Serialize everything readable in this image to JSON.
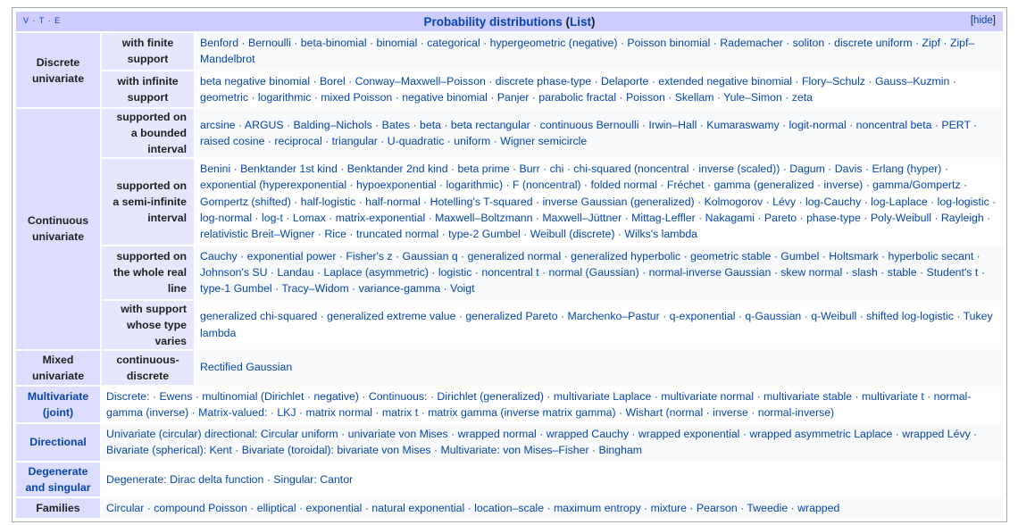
{
  "navbox": {
    "vte": "V · T · E",
    "title": "Probability distributions",
    "title_list": "List",
    "hide": "hide"
  },
  "groups": {
    "discrete": "Discrete univariate",
    "continuous": "Continuous univariate",
    "mixed": "Mixed univariate",
    "multivariate": "Multivariate (joint)",
    "directional": "Directional",
    "degenerate": "Degenerate and singular",
    "families": "Families"
  },
  "subgroups": {
    "finite": "with finite support",
    "infinite": "with infinite support",
    "bounded": "supported on a bounded interval",
    "semi": "supported on a semi-infinite interval",
    "real": "supported on the whole real line",
    "varies": "with support whose type varies",
    "contdisc": "continuous-discrete"
  },
  "rows": {
    "finite": "Benford · Bernoulli · beta-binomial · binomial · categorical · hypergeometric (negative) · Poisson binomial · Rademacher · soliton · discrete uniform · Zipf · Zipf–Mandelbrot",
    "infinite": "beta negative binomial · Borel · Conway–Maxwell–Poisson · discrete phase-type · Delaporte · extended negative binomial · Flory–Schulz · Gauss–Kuzmin · geometric · logarithmic · mixed Poisson · negative binomial · Panjer · parabolic fractal · Poisson · Skellam · Yule–Simon · zeta",
    "bounded": "arcsine · ARGUS · Balding–Nichols · Bates · beta · beta rectangular · continuous Bernoulli · Irwin–Hall · Kumaraswamy · logit-normal · noncentral beta · PERT · raised cosine · reciprocal · triangular · U-quadratic · uniform · Wigner semicircle",
    "semi": "Benini · Benktander 1st kind · Benktander 2nd kind · beta prime · Burr · chi · chi-squared (noncentral · inverse (scaled)) · Dagum · Davis · Erlang (hyper) · exponential (hyperexponential · hypoexponential · logarithmic) · F (noncentral) · folded normal · Fréchet · gamma (generalized · inverse) · gamma/Gompertz · Gompertz (shifted) · half-logistic · half-normal · Hotelling's T-squared · inverse Gaussian (generalized) · Kolmogorov · Lévy · log-Cauchy · log-Laplace · log-logistic · log-normal · log-t · Lomax · matrix-exponential · Maxwell–Boltzmann · Maxwell–Jüttner · Mittag-Leffler · Nakagami · Pareto · phase-type · Poly-Weibull · Rayleigh · relativistic Breit–Wigner · Rice · truncated normal · type-2 Gumbel · Weibull (discrete) · Wilks's lambda",
    "real": "Cauchy · exponential power · Fisher's z · Gaussian q · generalized normal · generalized hyperbolic · geometric stable · Gumbel · Holtsmark · hyperbolic secant · Johnson's SU · Landau · Laplace (asymmetric) · logistic · noncentral t · normal (Gaussian) · normal-inverse Gaussian · skew normal · slash · stable · Student's t · type-1 Gumbel · Tracy–Widom · variance-gamma · Voigt",
    "varies": "generalized chi-squared · generalized extreme value · generalized Pareto · Marchenko–Pastur · q-exponential · q-Gaussian · q-Weibull · shifted log-logistic · Tukey lambda",
    "contdisc": "Rectified Gaussian",
    "multivariate": "Discrete: · Ewens · multinomial (Dirichlet · negative) · Continuous: · Dirichlet (generalized) · multivariate Laplace · multivariate normal · multivariate stable · multivariate t · normal-gamma (inverse) · Matrix-valued: · LKJ · matrix normal · matrix t · matrix gamma (inverse matrix gamma) · Wishart (normal · inverse · normal-inverse)",
    "directional": "Univariate (circular) directional: Circular uniform · univariate von Mises · wrapped normal · wrapped Cauchy · wrapped exponential · wrapped asymmetric Laplace · wrapped Lévy · Bivariate (spherical): Kent · Bivariate (toroidal): bivariate von Mises · Multivariate: von Mises–Fisher · Bingham",
    "degenerate": "Degenerate: Dirac delta function · Singular: Cantor",
    "families": "Circular · compound Poisson · elliptical · exponential · natural exponential · location–scale · maximum entropy · mixture · Pearson · Tweedie · wrapped"
  }
}
